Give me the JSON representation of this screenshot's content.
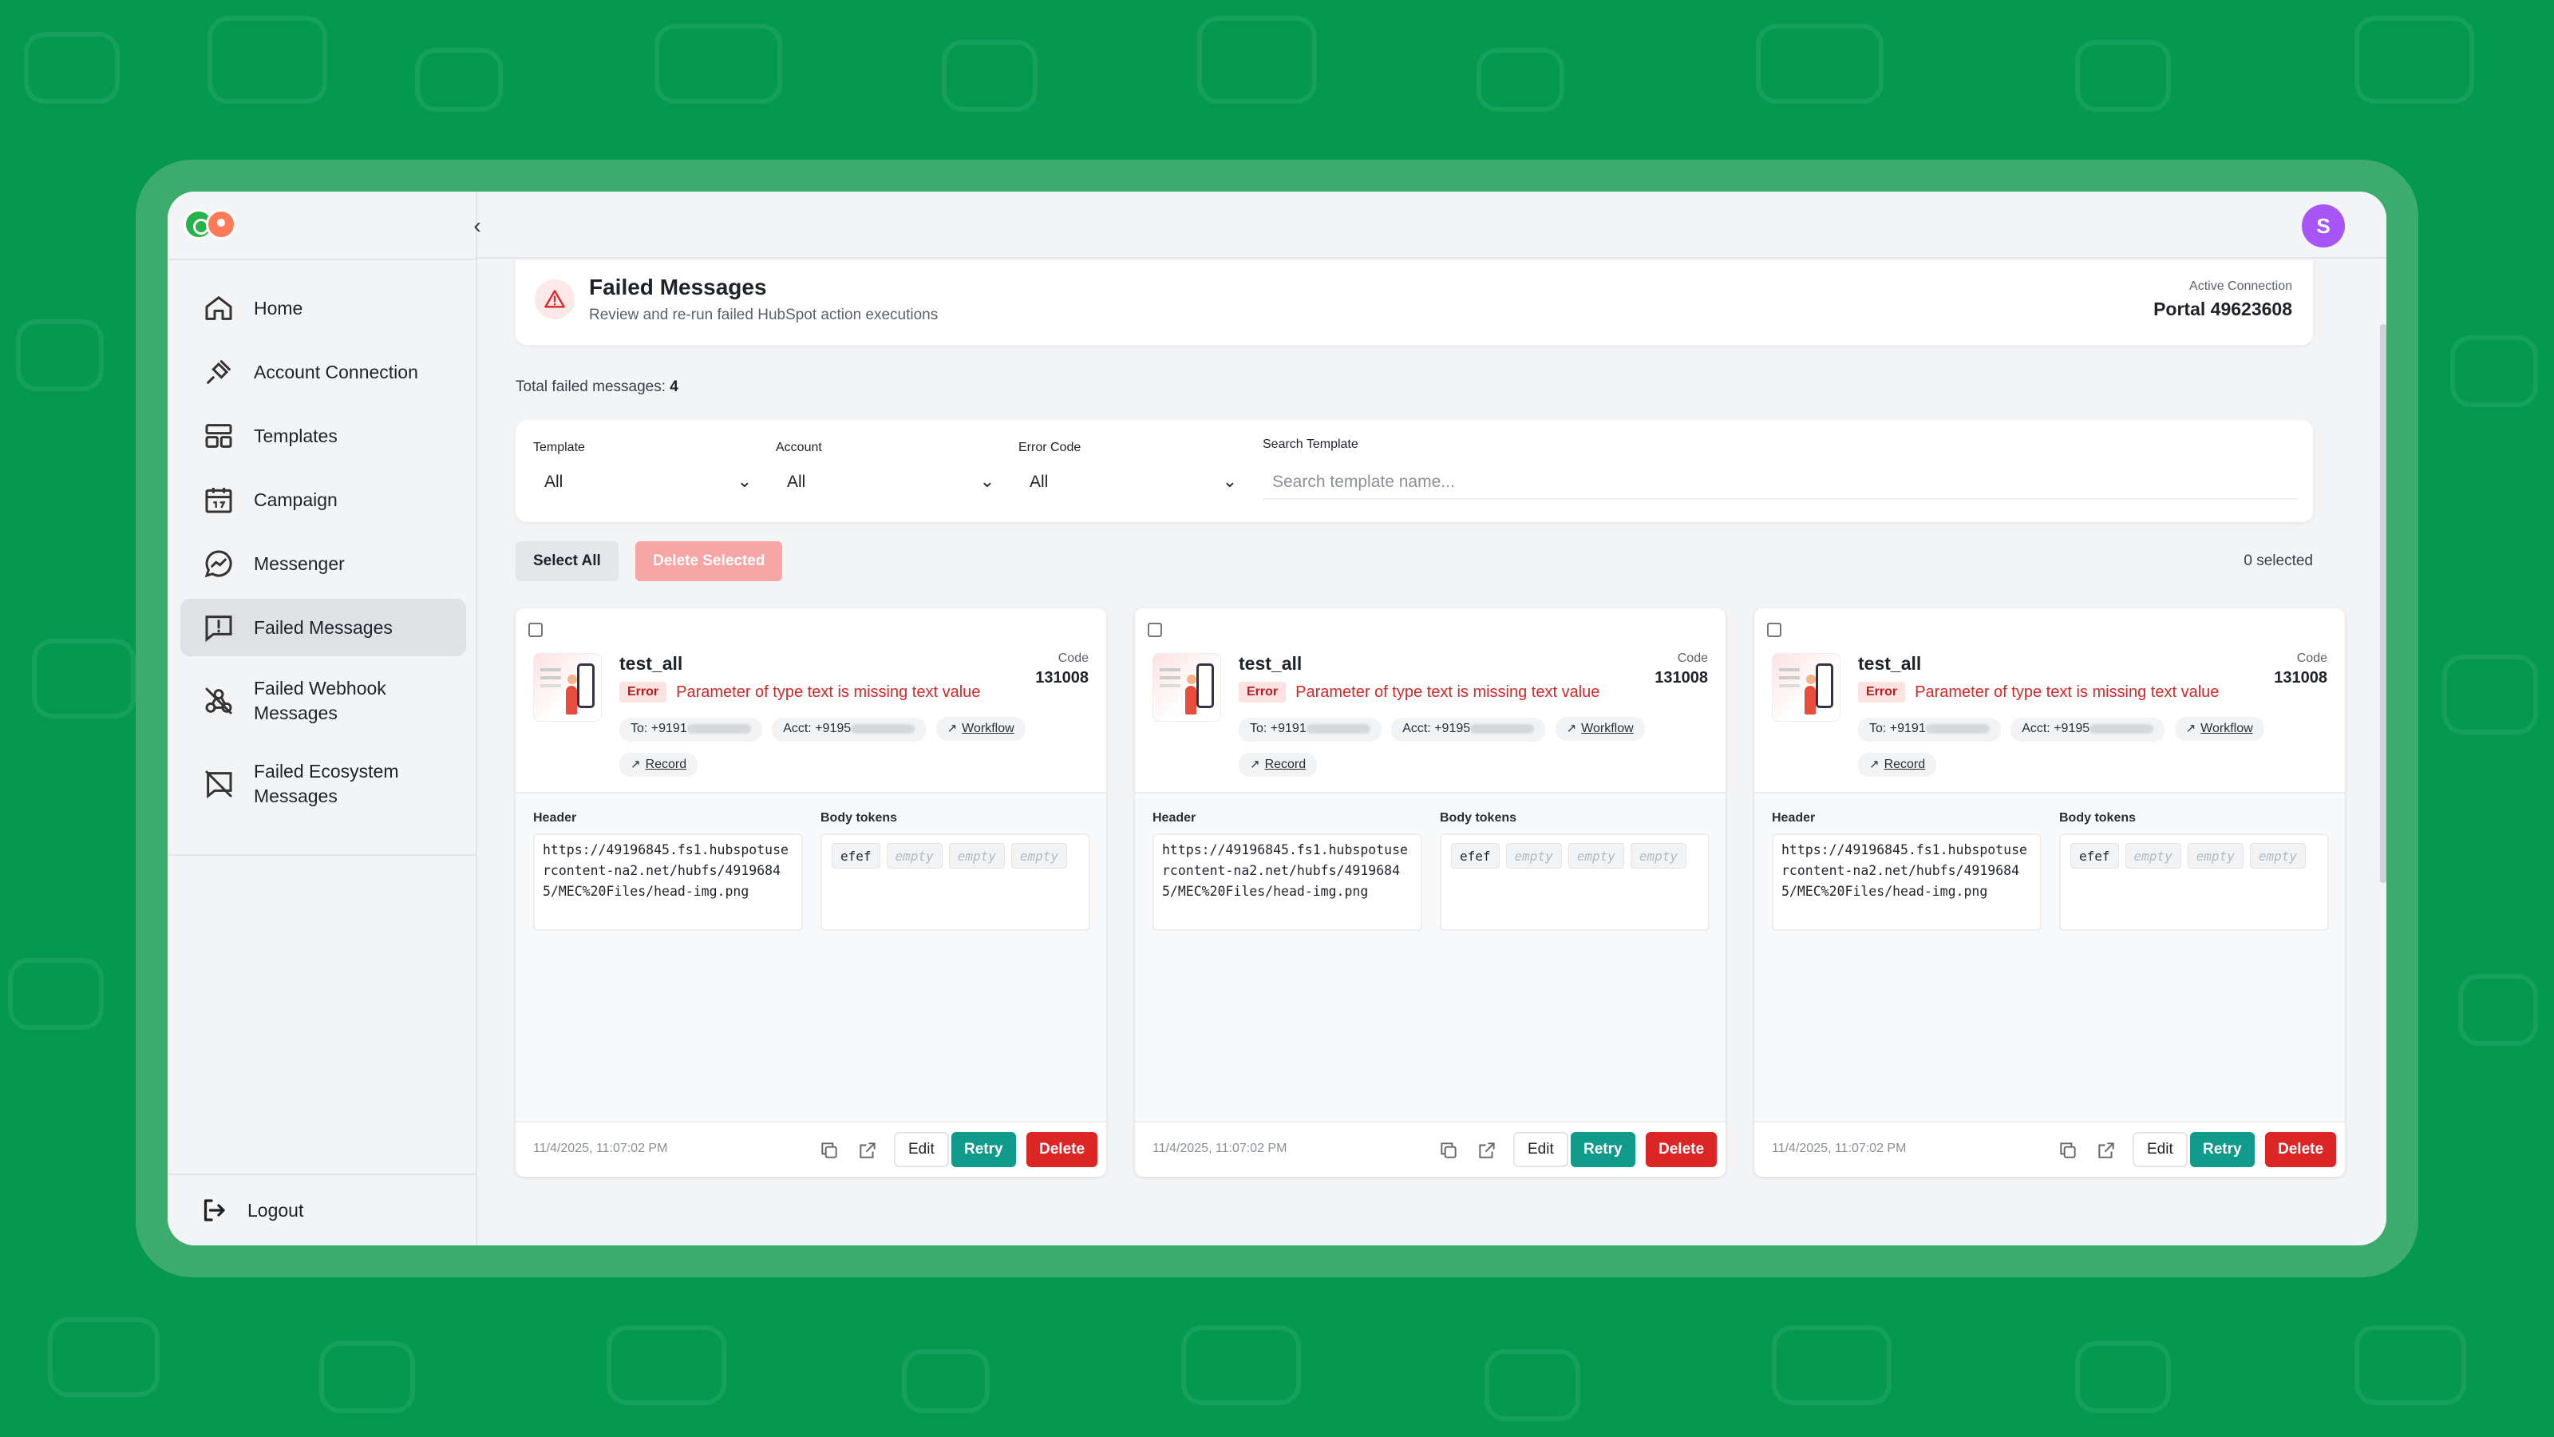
{
  "sidebar": {
    "items": [
      {
        "label": "Home",
        "icon": "home-icon",
        "active": false
      },
      {
        "label": "Account Connection",
        "icon": "plug-icon",
        "active": false
      },
      {
        "label": "Templates",
        "icon": "layout-icon",
        "active": false
      },
      {
        "label": "Campaign",
        "icon": "calendar-icon",
        "active": false
      },
      {
        "label": "Messenger",
        "icon": "messenger-icon",
        "active": false
      },
      {
        "label": "Failed Messages",
        "icon": "message-alert-icon",
        "active": true
      },
      {
        "label": "Failed Webhook Messages",
        "icon": "webhook-off-icon",
        "active": false
      },
      {
        "label": "Failed Ecosystem Messages",
        "icon": "message-off-icon",
        "active": false
      }
    ],
    "logout_label": "Logout",
    "collapse_glyph": "‹"
  },
  "topbar": {
    "avatar_initial": "S"
  },
  "page": {
    "title": "Failed Messages",
    "subtitle": "Review and re-run failed HubSpot action executions",
    "connection_label": "Active Connection",
    "connection_value": "Portal 49623608",
    "total_label": "Total failed messages:",
    "total_value": "4"
  },
  "filters": {
    "template": {
      "label": "Template",
      "value": "All"
    },
    "account": {
      "label": "Account",
      "value": "All"
    },
    "error_code": {
      "label": "Error Code",
      "value": "All"
    },
    "search": {
      "label": "Search Template",
      "placeholder": "Search template name..."
    }
  },
  "toolbar": {
    "select_all": "Select All",
    "delete_selected": "Delete Selected",
    "selected_count": "0 selected"
  },
  "cards": [
    {
      "name": "test_all",
      "code_label": "Code",
      "code": "131008",
      "error_badge": "Error",
      "error_message": "Parameter of type text is missing text value",
      "to_label": "To: +9191",
      "acct_label": "Acct: +9195",
      "workflow_label": "Workflow",
      "record_label": "Record",
      "header_label": "Header",
      "header_value": "https://49196845.fs1.hubspotusercontent-na2.net/hubfs/49196845/MEC%20Files/head-img.png",
      "tokens_label": "Body tokens",
      "tokens": [
        "efef",
        "empty",
        "empty",
        "empty"
      ],
      "timestamp": "11/4/2025, 11:07:02 PM",
      "edit": "Edit",
      "retry": "Retry",
      "delete": "Delete"
    },
    {
      "name": "test_all",
      "code_label": "Code",
      "code": "131008",
      "error_badge": "Error",
      "error_message": "Parameter of type text is missing text value",
      "to_label": "To: +9191",
      "acct_label": "Acct: +9195",
      "workflow_label": "Workflow",
      "record_label": "Record",
      "header_label": "Header",
      "header_value": "https://49196845.fs1.hubspotusercontent-na2.net/hubfs/49196845/MEC%20Files/head-img.png",
      "tokens_label": "Body tokens",
      "tokens": [
        "efef",
        "empty",
        "empty",
        "empty"
      ],
      "timestamp": "11/4/2025, 11:07:02 PM",
      "edit": "Edit",
      "retry": "Retry",
      "delete": "Delete"
    },
    {
      "name": "test_all",
      "code_label": "Code",
      "code": "131008",
      "error_badge": "Error",
      "error_message": "Parameter of type text is missing text value",
      "to_label": "To: +9191",
      "acct_label": "Acct: +9195",
      "workflow_label": "Workflow",
      "record_label": "Record",
      "header_label": "Header",
      "header_value": "https://49196845.fs1.hubspotusercontent-na2.net/hubfs/49196845/MEC%20Files/head-img.png",
      "tokens_label": "Body tokens",
      "tokens": [
        "efef",
        "empty",
        "empty",
        "empty"
      ],
      "timestamp": "11/4/2025, 11:07:02 PM",
      "edit": "Edit",
      "retry": "Retry",
      "delete": "Delete"
    }
  ],
  "colors": {
    "background": "#04994f",
    "frame": "#3cab6c",
    "retry": "#0f9a8a",
    "delete": "#dc2626",
    "delete_selected": "#f8a5a5",
    "avatar": "#a855f7",
    "error_text": "#dc2626"
  }
}
